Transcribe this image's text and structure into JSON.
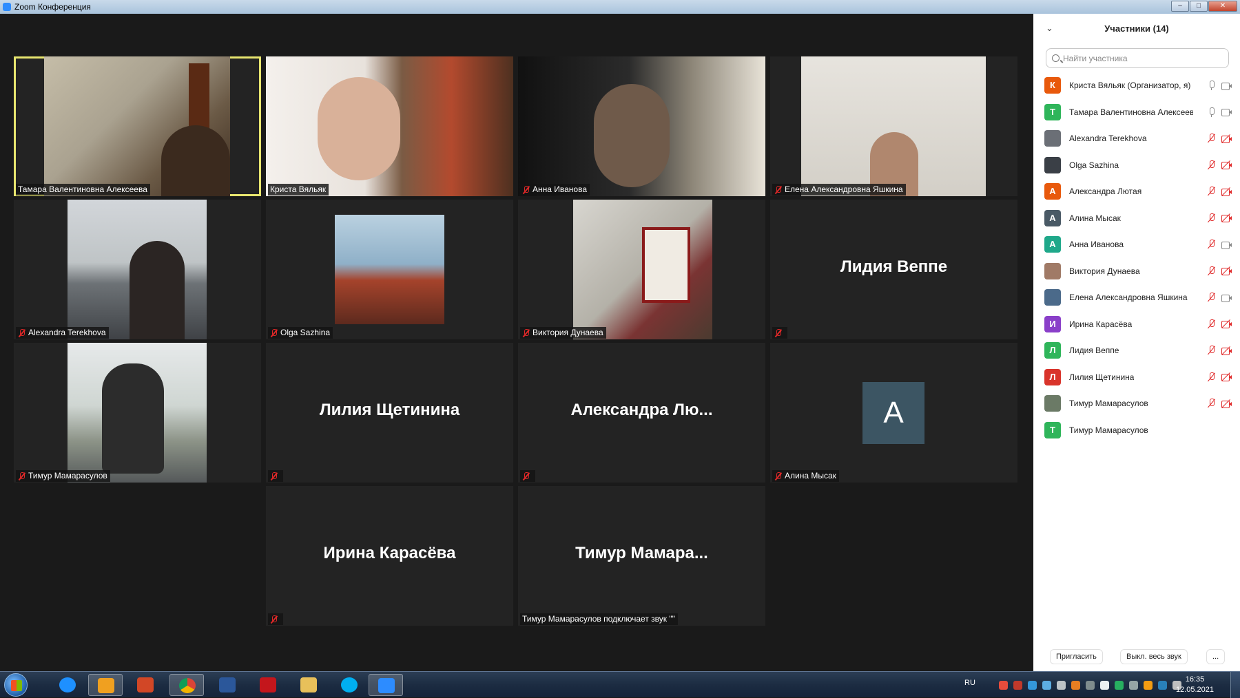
{
  "window": {
    "title": "Zoom Конференция",
    "minimize": "–",
    "maximize": "□",
    "close": "✕"
  },
  "tiles": [
    {
      "name": "Тамара Валентиновна Алексеева"
    },
    {
      "name": "Криста Вяльяк"
    },
    {
      "name": "Анна Иванова"
    },
    {
      "name": "Елена Александровна Яшкина"
    },
    {
      "name": "Alexandra Terekhova"
    },
    {
      "name": "Olga Sazhina"
    },
    {
      "name": "Виктория Дунаева"
    },
    {
      "big": "Лидия Веппе"
    },
    {
      "name": "Тимур Мамарасулов"
    },
    {
      "big": "Лилия Щетинина"
    },
    {
      "big": "Александра  Лю..."
    },
    {
      "name": "Алина Мысак",
      "avatar": "A"
    },
    {
      "big": "Ирина Карасёва"
    },
    {
      "big": "Тимур  Мамара...",
      "status": "Тимур Мамарасулов подключает звук \"\""
    }
  ],
  "panel": {
    "title": "Участники (14)",
    "collapse_icon": "chevron-down-icon",
    "search_placeholder": "Найти участника",
    "participants": [
      {
        "initial": "К",
        "name": "Криста Вяльяк (Организатор, я)",
        "color": "#e8590c"
      },
      {
        "initial": "Т",
        "name": "Тамара Валентиновна Алексеева",
        "color": "#2fb55a"
      },
      {
        "initial": "",
        "name": "Alexandra Terekhova",
        "color": "#6b6f76"
      },
      {
        "initial": "",
        "name": "Olga Sazhina",
        "color": "#3a3f46"
      },
      {
        "initial": "А",
        "name": "Александра Лютая",
        "color": "#e8590c"
      },
      {
        "initial": "А",
        "name": "Алина Мысак",
        "color": "#4a5a66"
      },
      {
        "initial": "А",
        "name": "Анна Иванова",
        "color": "#1fa88a"
      },
      {
        "initial": "",
        "name": "Виктория Дунаева",
        "color": "#a07a66"
      },
      {
        "initial": "",
        "name": "Елена Александровна Яшкина",
        "color": "#4b6a8a"
      },
      {
        "initial": "И",
        "name": "Ирина Карасёва",
        "color": "#8a3fc9"
      },
      {
        "initial": "Л",
        "name": "Лидия Веппе",
        "color": "#2fb55a"
      },
      {
        "initial": "Л",
        "name": "Лилия Щетинина",
        "color": "#d9342b"
      },
      {
        "initial": "",
        "name": "Тимур Мамарасулов",
        "color": "#6b7a66"
      },
      {
        "initial": "Т",
        "name": "Тимур Мамарасулов",
        "color": "#2fb55a"
      }
    ],
    "invite": "Пригласить",
    "mute_all": "Выкл. весь звук",
    "more": "..."
  },
  "taskbar": {
    "lang": "RU",
    "time": "16:35",
    "date": "12.05.2021",
    "apps": [
      "internet-explorer-icon",
      "media-player-icon",
      "powerpoint-icon",
      "chrome-icon",
      "word-icon",
      "acrobat-icon",
      "file-explorer-icon",
      "skype-icon",
      "zoom-icon"
    ]
  },
  "colors": {
    "active_speaker": "#e8e66f",
    "mic_off": "#e02828"
  }
}
